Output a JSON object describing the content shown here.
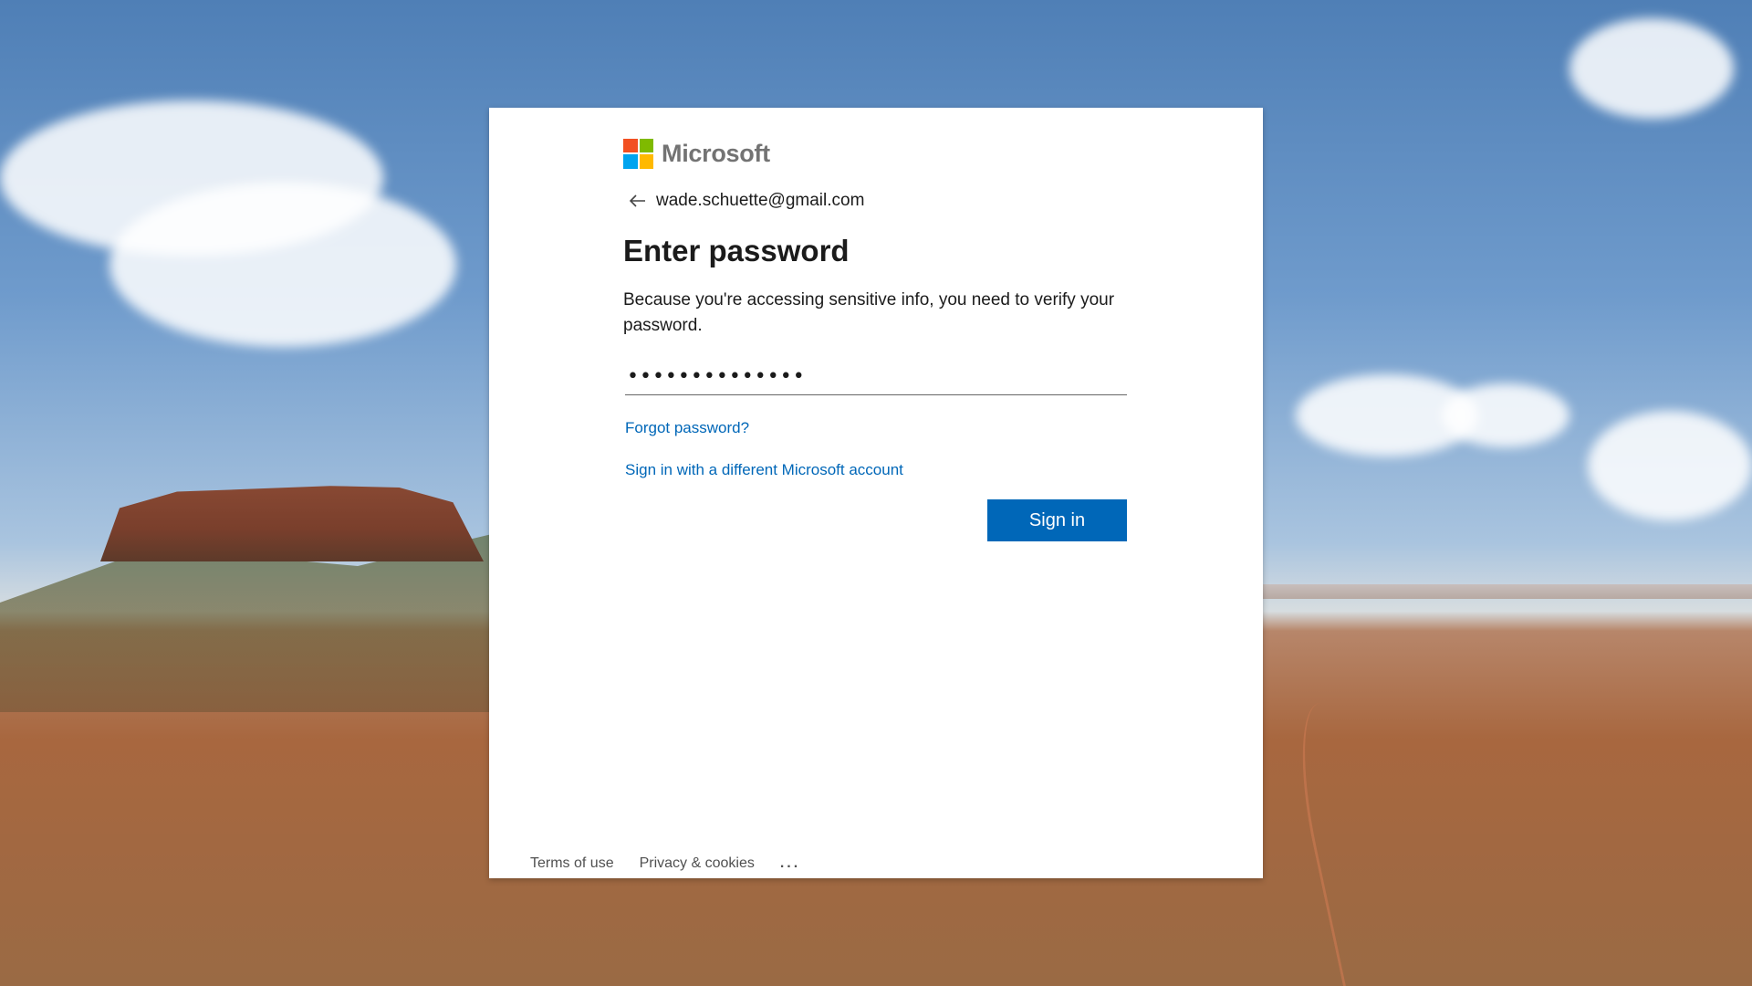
{
  "brand": {
    "name": "Microsoft"
  },
  "identity": {
    "email": "wade.schuette@gmail.com",
    "back_icon": "back-arrow-icon"
  },
  "header": {
    "title": "Enter password"
  },
  "message": {
    "text": "Because you're accessing sensitive info, you need to verify your password."
  },
  "password": {
    "value": "••••••••••••••"
  },
  "links": {
    "forgot": "Forgot password?",
    "different_account": "Sign in with a different Microsoft account"
  },
  "buttons": {
    "sign_in": "Sign in"
  },
  "footer": {
    "terms": "Terms of use",
    "privacy": "Privacy & cookies",
    "more": "..."
  },
  "colors": {
    "accent": "#0067b8",
    "logo_red": "#f25022",
    "logo_green": "#7fba00",
    "logo_blue": "#00a4ef",
    "logo_yellow": "#ffb900"
  }
}
